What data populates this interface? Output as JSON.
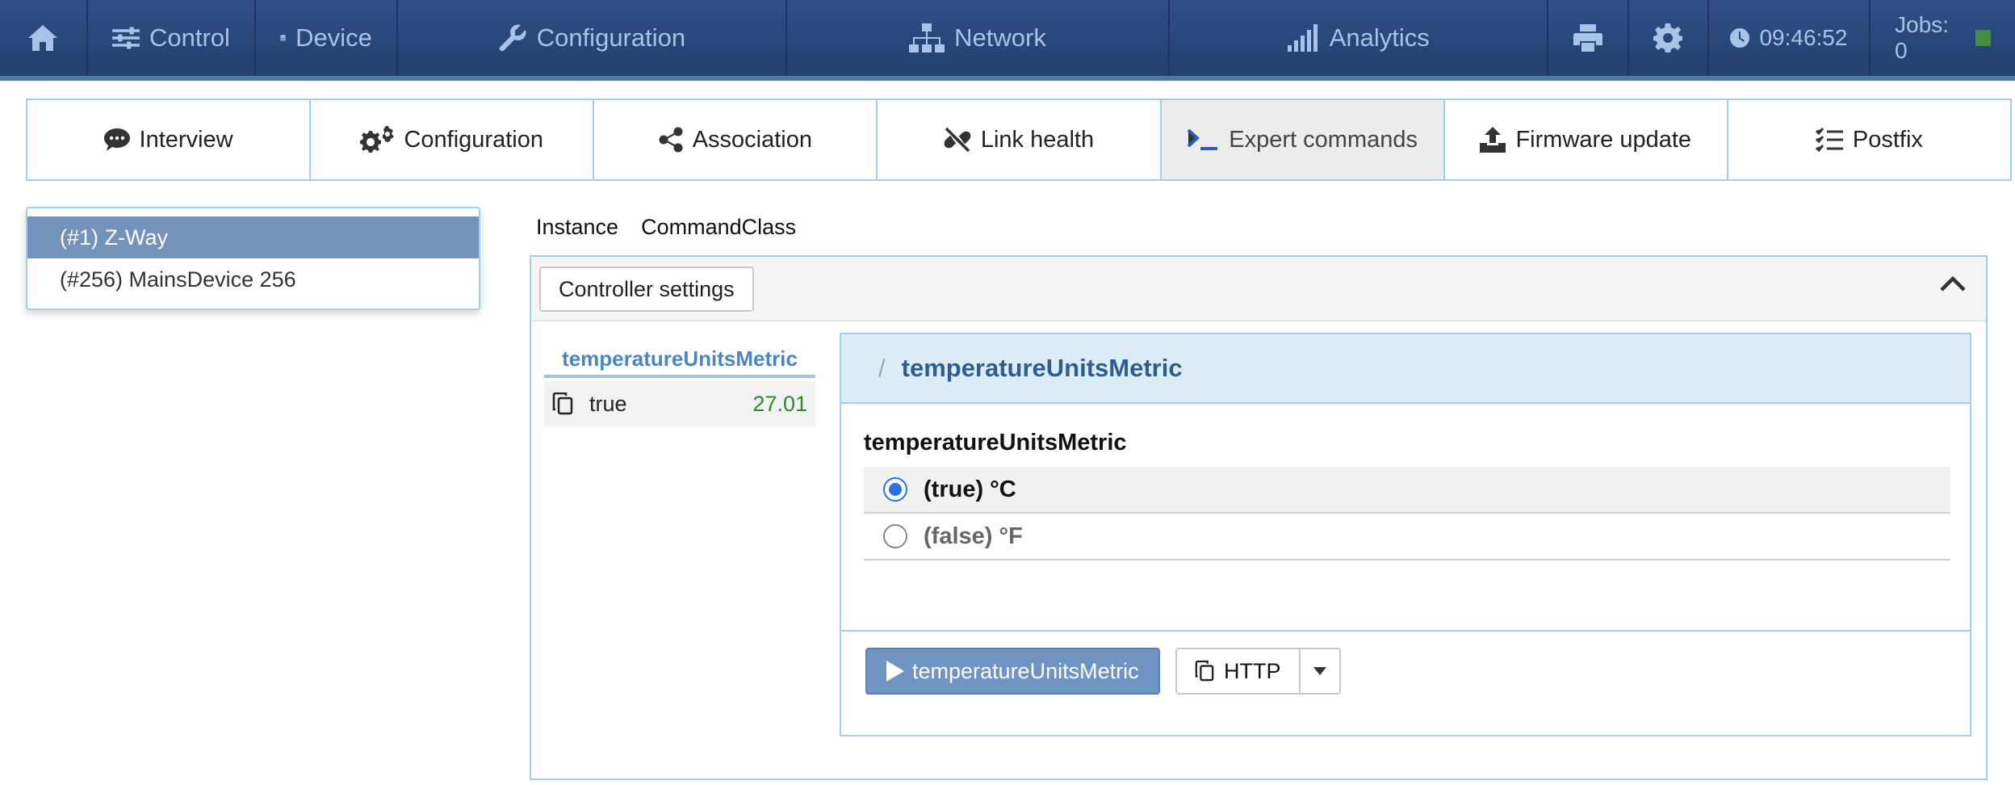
{
  "navbar": {
    "items": [
      {
        "label": "",
        "icon": "home-icon"
      },
      {
        "label": "Control",
        "icon": "sliders-icon"
      },
      {
        "label": "Device",
        "icon": "database-icon"
      },
      {
        "label": "Configuration",
        "icon": "wrench-icon"
      },
      {
        "label": "Network",
        "icon": "sitemap-icon"
      },
      {
        "label": "Analytics",
        "icon": "signal-bars-icon"
      },
      {
        "label": "",
        "icon": "printer-icon"
      },
      {
        "label": "",
        "icon": "gear-icon"
      }
    ],
    "clock": "09:46:52",
    "jobs": "Jobs: 0",
    "jobs_status_color": "#3f8f3f"
  },
  "tabs": [
    {
      "label": "Interview",
      "icon": "comment-icon"
    },
    {
      "label": "Configuration",
      "icon": "gears-icon"
    },
    {
      "label": "Association",
      "icon": "share-icon"
    },
    {
      "label": "Link health",
      "icon": "unlink-icon"
    },
    {
      "label": "Expert commands",
      "icon": "terminal-icon",
      "active": true
    },
    {
      "label": "Firmware update",
      "icon": "upload-icon"
    },
    {
      "label": "Postfix",
      "icon": "checklist-icon"
    }
  ],
  "devices": [
    {
      "label": "(#1) Z-Way",
      "selected": true
    },
    {
      "label": "(#256) MainsDevice 256",
      "selected": false
    }
  ],
  "crumbs": [
    "Instance",
    "CommandClass"
  ],
  "panel": {
    "header_button": "Controller settings",
    "tree_tab": "temperatureUnitsMetric",
    "tree_value": "true",
    "tree_time": "27.01"
  },
  "card": {
    "slash": "/",
    "title": "temperatureUnitsMetric",
    "param_label": "temperatureUnitsMetric",
    "options": [
      {
        "label": "(true) °C",
        "checked": true
      },
      {
        "label": "(false) °F",
        "checked": false
      }
    ],
    "run_button": "temperatureUnitsMetric",
    "http_button": "HTTP"
  },
  "colors": {
    "navbar": "#2a4a7f",
    "accent": "#6f94c2",
    "selected_device": "#7592bb",
    "time_green": "#2c8a2c"
  }
}
